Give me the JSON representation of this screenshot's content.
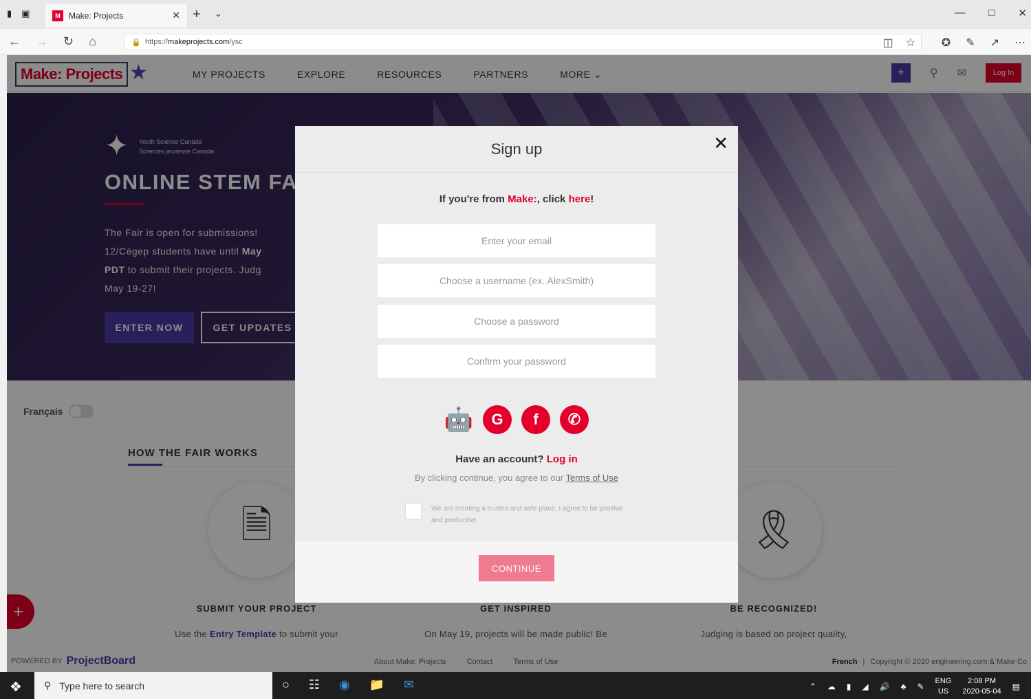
{
  "browser": {
    "tab_favicon": "M",
    "tab_title": "Make: Projects",
    "url_prefix": "https://",
    "url_domain": "makeprojects.com",
    "url_path": "/ysc"
  },
  "site": {
    "logo_text": "Make: Projects",
    "menu": [
      "MY PROJECTS",
      "EXPLORE",
      "RESOURCES",
      "PARTNERS",
      "MORE ⌄"
    ],
    "login_label": "Log In",
    "plus_label": "+"
  },
  "hero": {
    "org_line1": "Youth Science Canada",
    "org_line2": "Sciences jeunesse Canada",
    "title": "ONLINE STEM FA",
    "text_1": "The Fair is open for submissions! ",
    "text_2": "12/Cégep students have until ",
    "text_bold_1": "May",
    "text_bold_2": "PDT",
    "text_3": " to submit their projects. Judg",
    "text_4": "May 19-27!",
    "enter_label": "ENTER NOW",
    "updates_label": "GET UPDATES"
  },
  "page": {
    "lang_label": "Français",
    "how_title": "HOW THE FAIR WORKS",
    "col1_title": "SUBMIT YOUR PROJECT",
    "col1_text_a": "Use the ",
    "col1_link": "Entry Template",
    "col1_text_b": " to submit your",
    "col2_title": "GET INSPIRED",
    "col2_text": "On May 19, projects will be made public! Be",
    "col3_title": "BE RECOGNIZED!",
    "col3_text": "Judging is based on project quality,"
  },
  "footer": {
    "powered": "POWERED BY",
    "brand": "ProjectBoard",
    "links": [
      "About Make: Projects",
      "Contact",
      "Terms of Use"
    ],
    "lang": "French",
    "copyright": "Copyright © 2020 engineering.com & Make Co"
  },
  "modal": {
    "title": "Sign up",
    "from_prefix": "If you're from ",
    "from_make": "Make:",
    "from_mid": ", click ",
    "from_here": "here",
    "from_end": "!",
    "email_placeholder": "Enter your email",
    "username_placeholder": "Choose a username (ex. AlexSmith)",
    "password_placeholder": "Choose a password",
    "confirm_placeholder": "Confirm your password",
    "have_account": "Have an account? ",
    "login_link": "Log in",
    "agree_prefix": "By clicking continue, you agree to our ",
    "terms_link": "Terms of Use",
    "pledge": "We are creating a trusted and safe place. I agree to be positive and productive",
    "continue_label": "CONTINUE",
    "close_symbol": "✕"
  },
  "taskbar": {
    "search_placeholder": "Type here to search",
    "lang_top": "ENG",
    "lang_bottom": "US",
    "time": "2:08 PM",
    "date": "2020-05-04"
  },
  "colors": {
    "brand_red": "#e4002b",
    "brand_purple": "#4b3aa6"
  }
}
